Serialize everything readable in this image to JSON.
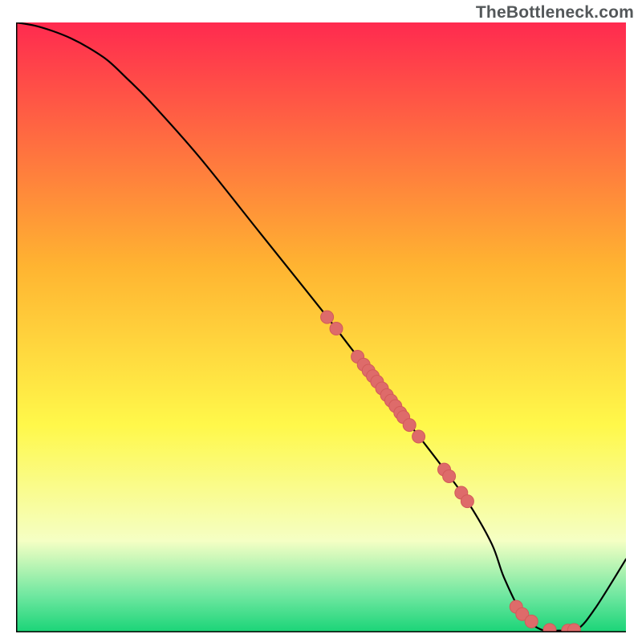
{
  "watermark": "TheBottleneck.com",
  "colors": {
    "gradient_top": "#ff2a4f",
    "gradient_mid1": "#ffb431",
    "gradient_mid2": "#fff84a",
    "gradient_pale": "#f5ffc4",
    "gradient_bottom_green1": "#6fe7a0",
    "gradient_bottom_green2": "#19d477",
    "line": "#000000",
    "dot_fill": "#de6b6a",
    "dot_stroke": "#d25a59",
    "axis": "#000000"
  },
  "chart_data": {
    "type": "line",
    "title": "",
    "xlabel": "",
    "ylabel": "",
    "xlim": [
      0,
      100
    ],
    "ylim": [
      0,
      100
    ],
    "grid": false,
    "legend": false,
    "annotations": [],
    "series": [
      {
        "name": "bottleneck-curve",
        "x": [
          0,
          3,
          6,
          9,
          12,
          15,
          18,
          22,
          30,
          40,
          50,
          55,
          60,
          65,
          70,
          74,
          78,
          80,
          83,
          86,
          89,
          92,
          95,
          100
        ],
        "y": [
          100,
          99.5,
          98.6,
          97.4,
          95.8,
          93.8,
          91.0,
          87.0,
          78.0,
          65.5,
          53.0,
          46.5,
          40.0,
          33.5,
          27.0,
          21.5,
          14.5,
          9.0,
          3.0,
          0.5,
          0.3,
          0.5,
          4.0,
          12.0
        ]
      }
    ],
    "points": {
      "name": "highlighted-values",
      "note": "scatter dots lying on the curve",
      "xy": [
        [
          51,
          51.7
        ],
        [
          52.5,
          49.8
        ],
        [
          56,
          45.2
        ],
        [
          57,
          43.9
        ],
        [
          57.8,
          42.9
        ],
        [
          58.5,
          42.0
        ],
        [
          59.2,
          41.1
        ],
        [
          60,
          40.0
        ],
        [
          60.8,
          38.9
        ],
        [
          61.5,
          38.0
        ],
        [
          62.2,
          37.1
        ],
        [
          63,
          36.0
        ],
        [
          63.5,
          35.3
        ],
        [
          64.5,
          34.0
        ],
        [
          66,
          32.1
        ],
        [
          70.2,
          26.7
        ],
        [
          71,
          25.6
        ],
        [
          73,
          22.9
        ],
        [
          74,
          21.5
        ],
        [
          82,
          4.2
        ],
        [
          83,
          3.0
        ],
        [
          84.5,
          1.8
        ],
        [
          87.5,
          0.4
        ],
        [
          90.5,
          0.3
        ],
        [
          91.5,
          0.4
        ]
      ]
    }
  }
}
